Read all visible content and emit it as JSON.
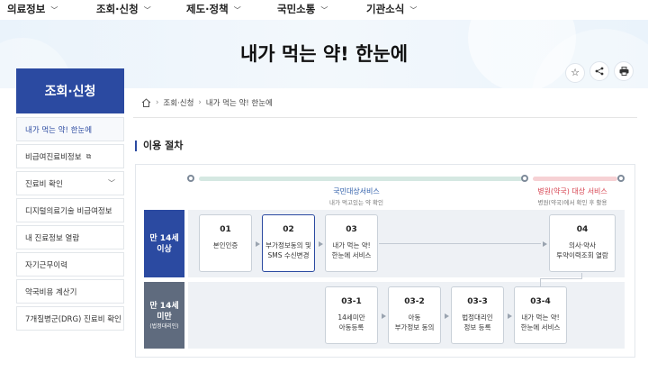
{
  "nav": {
    "items": [
      "의료정보",
      "조회·신청",
      "제도·정책",
      "국민소통",
      "기관소식"
    ]
  },
  "banner": {
    "title": "내가 먹는 약! 한눈에",
    "icons": [
      "star-icon",
      "share-icon",
      "print-icon"
    ]
  },
  "sidebar": {
    "title": "조회·신청",
    "items": [
      {
        "label": "내가 먹는 약! 한눈에",
        "active": true
      },
      {
        "label": "비급여진료비정보",
        "external": true
      },
      {
        "label": "진료비 확인",
        "expandable": true
      },
      {
        "label": "디지털의료기술 비급여정보"
      },
      {
        "label": "내 진료정보 열람"
      },
      {
        "label": "자기근무이력"
      },
      {
        "label": "약국비용 계산기"
      },
      {
        "label": "7개질병군(DRG) 진료비 확인"
      }
    ]
  },
  "breadcrumb": [
    "조회·신청",
    "내가 먹는 약! 한눈에"
  ],
  "section": {
    "title": "이용 절차"
  },
  "diagram": {
    "service_public": {
      "label": "국민대상서비스",
      "sub": "내가 먹고있는 약 확인",
      "color": "#d5e8e2"
    },
    "service_hospital": {
      "label": "병원(약국) 대상 서비스",
      "sub": "병원(약국)에서 확인 후 활용",
      "color": "#f6d1d4",
      "label_color": "#d6404e"
    },
    "over14": {
      "label": "만 14세",
      "label2": "이상",
      "color": "#2b4aa1"
    },
    "under14": {
      "label": "만 14세",
      "label2": "미만",
      "note": "(법정대리인)",
      "color": "#5f6b7e"
    },
    "steps_top": [
      {
        "num": "01",
        "label": "본인인증"
      },
      {
        "num": "02",
        "label": "부가정보동의 및\nSMS 수신변경",
        "highlight": true
      },
      {
        "num": "03",
        "label": "내가 먹는 약!\n한눈에 서비스"
      },
      {
        "num": "04",
        "label": "의사·약사\n투약이력조회 열람"
      }
    ],
    "steps_bottom": [
      {
        "num": "03-1",
        "label": "14세미만\n아동등록"
      },
      {
        "num": "03-2",
        "label": "아동\n부가정보 동의"
      },
      {
        "num": "03-3",
        "label": "법정대리인\n정보 등록"
      },
      {
        "num": "03-4",
        "label": "내가 먹는 약!\n한눈에 서비스"
      }
    ]
  }
}
